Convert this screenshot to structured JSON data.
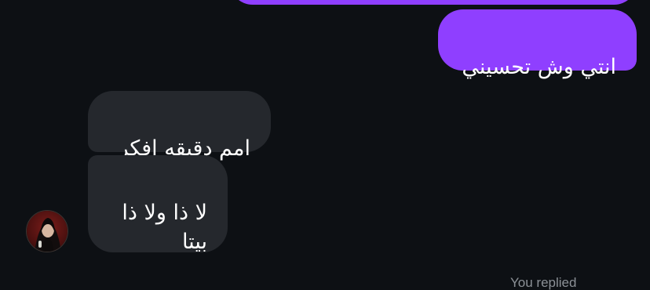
{
  "messages": {
    "outgoing": [
      {
        "text": "انتي وش تحسيني"
      }
    ],
    "incoming": [
      {
        "text": "امم دقيقه افكر"
      },
      {
        "text": "لا ذا ولا ذا\nبيتا"
      }
    ]
  },
  "footer": {
    "cut_text": "You replied"
  },
  "colors": {
    "background": "#0d1014",
    "outgoing_bubble": "#8f3fff",
    "incoming_bubble": "#25282d",
    "text": "#ffffff"
  },
  "avatar": {
    "icon": "profile-photo"
  }
}
